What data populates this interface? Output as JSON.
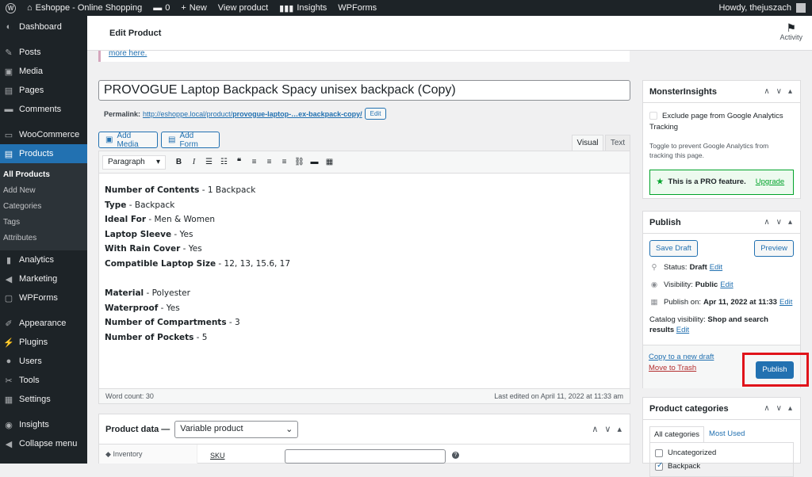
{
  "adminbar": {
    "site_name": "Eshoppe - Online Shopping",
    "comments_count": "0",
    "new_label": "New",
    "view_product": "View product",
    "insights": "Insights",
    "wpforms": "WPForms",
    "howdy": "Howdy, thejuszach"
  },
  "sidebar": {
    "items": [
      {
        "label": "Dashboard",
        "icon": "dashboard-icon"
      },
      {
        "label": "Posts",
        "icon": "pin-icon"
      },
      {
        "label": "Media",
        "icon": "media-icon"
      },
      {
        "label": "Pages",
        "icon": "page-icon"
      },
      {
        "label": "Comments",
        "icon": "comment-icon"
      },
      {
        "label": "WooCommerce",
        "icon": "woo-icon"
      },
      {
        "label": "Products",
        "icon": "products-icon"
      },
      {
        "label": "Analytics",
        "icon": "analytics-icon"
      },
      {
        "label": "Marketing",
        "icon": "megaphone-icon"
      },
      {
        "label": "WPForms",
        "icon": "forms-icon"
      },
      {
        "label": "Appearance",
        "icon": "brush-icon"
      },
      {
        "label": "Plugins",
        "icon": "plugin-icon"
      },
      {
        "label": "Users",
        "icon": "users-icon"
      },
      {
        "label": "Tools",
        "icon": "wrench-icon"
      },
      {
        "label": "Settings",
        "icon": "settings-icon"
      },
      {
        "label": "Insights",
        "icon": "insights-icon"
      },
      {
        "label": "Collapse menu",
        "icon": "collapse-icon"
      }
    ],
    "submenu": [
      "All Products",
      "Add New",
      "Categories",
      "Tags",
      "Attributes"
    ]
  },
  "header": {
    "title": "Edit Product",
    "activity": "Activity"
  },
  "notice": {
    "link": "more here."
  },
  "post": {
    "title": "PROVOGUE Laptop Backpack Spacy unisex backpack (Copy)",
    "permalink_label": "Permalink:",
    "permalink_base": "http://eshoppe.local/product/",
    "permalink_slug": "provogue-laptop-…ex-backpack-copy/",
    "permalink_edit": "Edit"
  },
  "editor": {
    "add_media": "Add Media",
    "add_form": "Add Form",
    "tab_visual": "Visual",
    "tab_text": "Text",
    "format": "Paragraph",
    "lines": [
      {
        "bold": "Number of Contents",
        "rest": " - 1 Backpack"
      },
      {
        "bold": "Type",
        "rest": " - Backpack"
      },
      {
        "bold": "Ideal For",
        "rest": " - Men & Women"
      },
      {
        "bold": "Laptop Sleeve",
        "rest": " - Yes"
      },
      {
        "bold": "With Rain Cover",
        "rest": " - Yes"
      },
      {
        "bold": "Compatible Laptop Size",
        "rest": " - 12, 13, 15.6, 17"
      },
      {
        "bold": "",
        "rest": ""
      },
      {
        "bold": "Material",
        "rest": " - Polyester"
      },
      {
        "bold": "Waterproof",
        "rest": " -  Yes"
      },
      {
        "bold": "Number of Compartments",
        "rest": " - 3"
      },
      {
        "bold": "Number of Pockets",
        "rest": " - 5"
      }
    ],
    "word_count": "Word count: 30",
    "last_edited": "Last edited on April 11, 2022 at 11:33 am"
  },
  "product_data": {
    "label": "Product data —",
    "type": "Variable product",
    "nav_inventory": "Inventory",
    "sku_label": "SKU"
  },
  "monsterinsights": {
    "title": "MonsterInsights",
    "exclude": "Exclude page from Google Analytics Tracking",
    "toggle_text": "Toggle to prevent Google Analytics from tracking this page.",
    "pro": "This is a PRO feature.",
    "upgrade": "Upgrade"
  },
  "publish": {
    "title": "Publish",
    "save_draft": "Save Draft",
    "preview": "Preview",
    "status_label": "Status:",
    "status_value": "Draft",
    "visibility_label": "Visibility:",
    "visibility_value": "Public",
    "publish_on_label": "Publish on:",
    "publish_on_value": "Apr 11, 2022 at 11:33",
    "catalog_label": "Catalog visibility:",
    "catalog_value": "Shop and search results",
    "edit": "Edit",
    "copy_draft": "Copy to a new draft",
    "trash": "Move to Trash",
    "publish_button": "Publish"
  },
  "categories": {
    "title": "Product categories",
    "tab_all": "All categories",
    "tab_most": "Most Used",
    "items": [
      {
        "label": "Uncategorized",
        "checked": false
      },
      {
        "label": "Backpack",
        "checked": true
      }
    ]
  }
}
